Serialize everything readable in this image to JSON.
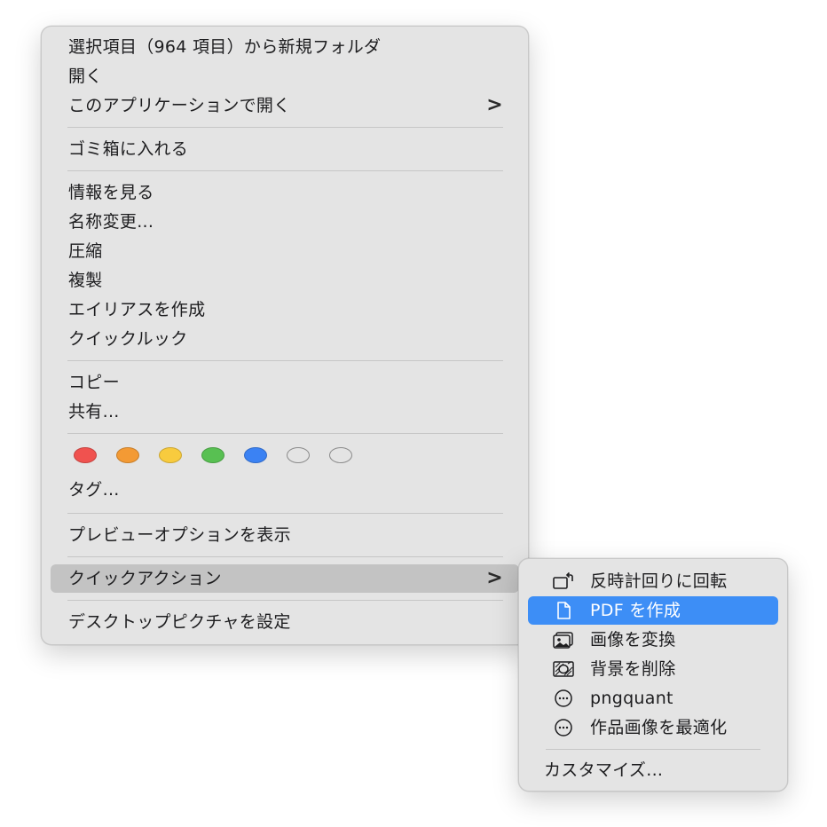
{
  "context_menu": {
    "new_folder_from_selection": "選択項目（964 項目）から新規フォルダ",
    "open": "開く",
    "open_with": "このアプリケーションで開く",
    "move_to_trash": "ゴミ箱に入れる",
    "get_info": "情報を見る",
    "rename": "名称変更...",
    "compress": "圧縮",
    "duplicate": "複製",
    "make_alias": "エイリアスを作成",
    "quick_look": "クイックルック",
    "copy": "コピー",
    "share": "共有...",
    "tags_label": "タグ...",
    "show_preview_options": "プレビューオプションを表示",
    "quick_actions": "クイックアクション",
    "set_desktop_picture": "デスクトップピクチャを設定",
    "submenu_chevron": ">",
    "tag_colors": [
      "#f0524f",
      "#f39a34",
      "#f8cb3e",
      "#58c052",
      "#3b82f3",
      "none",
      "none"
    ]
  },
  "quick_actions_submenu": {
    "items": [
      {
        "label": "反時計回りに回転",
        "icon": "rotate-left-icon"
      },
      {
        "label": "PDF を作成",
        "icon": "document-icon"
      },
      {
        "label": "画像を変換",
        "icon": "photos-icon"
      },
      {
        "label": "背景を削除",
        "icon": "remove-background-icon"
      },
      {
        "label": "pngquant",
        "icon": "ellipsis-circle-icon"
      },
      {
        "label": "作品画像を最適化",
        "icon": "ellipsis-circle-icon"
      }
    ],
    "customize": "カスタマイズ...",
    "selected_color": "#3d8ef6"
  }
}
